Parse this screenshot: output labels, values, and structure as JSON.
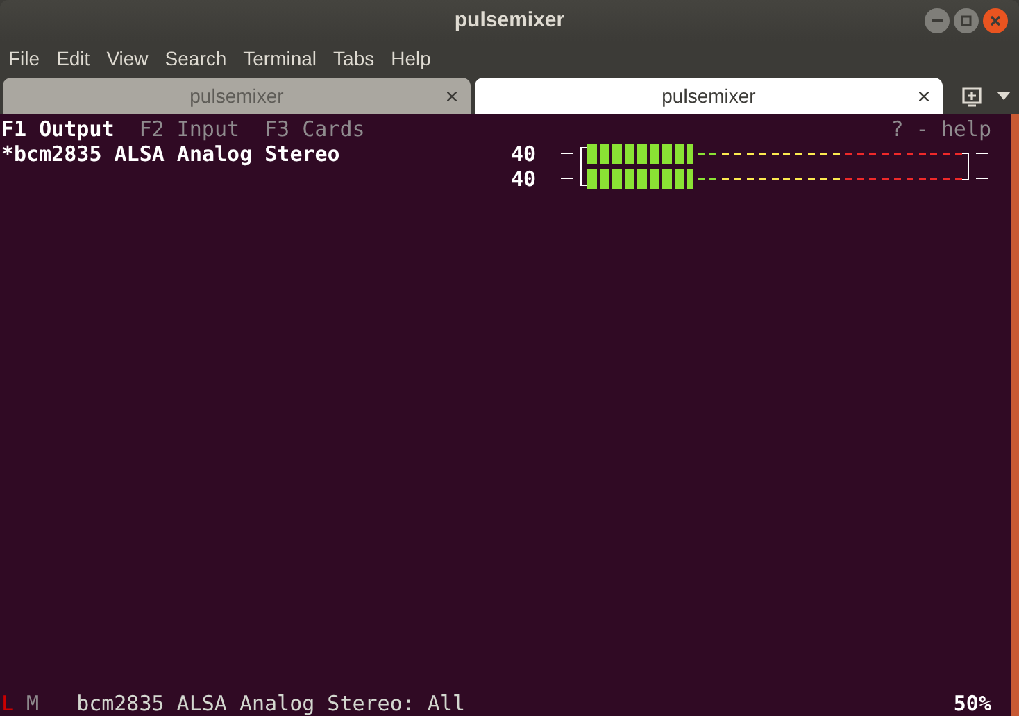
{
  "window": {
    "title": "pulsemixer"
  },
  "menu": [
    "File",
    "Edit",
    "View",
    "Search",
    "Terminal",
    "Tabs",
    "Help"
  ],
  "tabs": [
    {
      "label": "pulsemixer",
      "selected": false
    },
    {
      "label": "pulsemixer",
      "selected": true
    }
  ],
  "terminal": {
    "views": [
      {
        "label": "F1 Output",
        "selected": true
      },
      {
        "label": "F2 Input",
        "selected": false
      },
      {
        "label": "F3 Cards",
        "selected": false
      }
    ],
    "help": "? - help",
    "devices": [
      {
        "name": "*bcm2835 ALSA Analog Stereo",
        "selected": true,
        "channels": [
          {
            "reading": "40",
            "level": 0.28
          },
          {
            "reading": "40",
            "level": 0.28
          }
        ]
      }
    ],
    "status": {
      "lock": {
        "label": "L",
        "on": true
      },
      "mute": {
        "label": "M",
        "on": false
      },
      "text": "bcm2835 ALSA Analog Stereo: All",
      "volume": "50%"
    }
  }
}
